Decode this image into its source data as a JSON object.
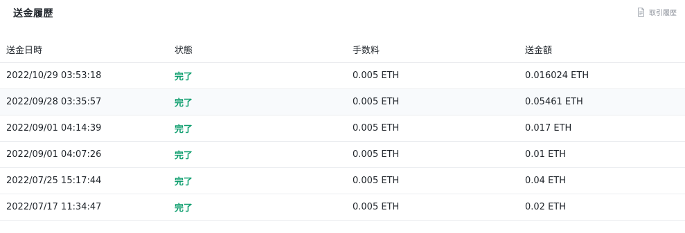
{
  "header": {
    "title": "送金履歴",
    "history_link_label": "取引履歴",
    "history_icon": "document-icon"
  },
  "table": {
    "columns": [
      "送金日時",
      "状態",
      "手数料",
      "送金額"
    ],
    "rows": [
      {
        "date": "2022/10/29 03:53:18",
        "status": "完了",
        "fee": "0.005 ETH",
        "amount": "0.016024 ETH"
      },
      {
        "date": "2022/09/28 03:35:57",
        "status": "完了",
        "fee": "0.005 ETH",
        "amount": "0.05461 ETH"
      },
      {
        "date": "2022/09/01 04:14:39",
        "status": "完了",
        "fee": "0.005 ETH",
        "amount": "0.017 ETH"
      },
      {
        "date": "2022/09/01 04:07:26",
        "status": "完了",
        "fee": "0.005 ETH",
        "amount": "0.01 ETH"
      },
      {
        "date": "2022/07/25 15:17:44",
        "status": "完了",
        "fee": "0.005 ETH",
        "amount": "0.04 ETH"
      },
      {
        "date": "2022/07/17 11:34:47",
        "status": "完了",
        "fee": "0.005 ETH",
        "amount": "0.02 ETH"
      }
    ]
  },
  "colors": {
    "status_done": "#0e9e6e",
    "row_alt_bg": "#f8fafc",
    "divider": "#eaecef"
  }
}
